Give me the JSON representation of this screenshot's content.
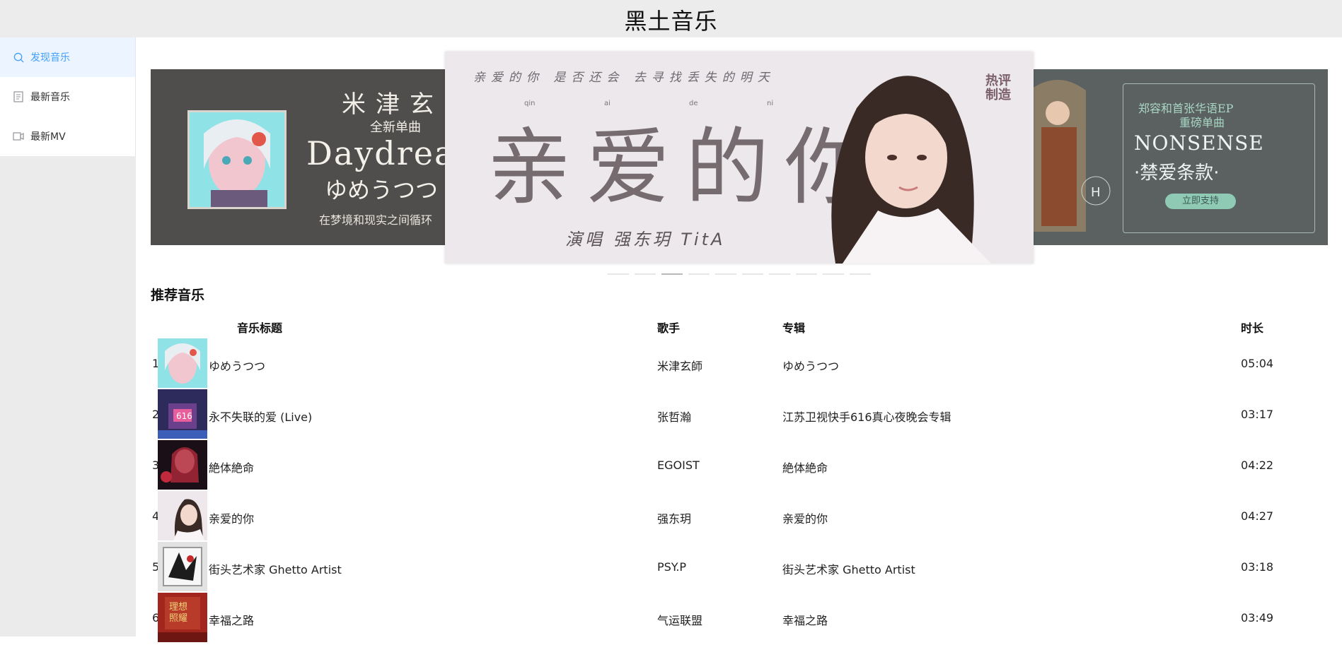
{
  "app": {
    "title": "黑土音乐"
  },
  "sidebar": {
    "items": [
      {
        "label": "发现音乐",
        "icon": "search-icon",
        "active": true
      },
      {
        "label": "最新音乐",
        "icon": "document-icon",
        "active": false
      },
      {
        "label": "最新MV",
        "icon": "video-icon",
        "active": false
      }
    ]
  },
  "carousel": {
    "slide_count": 10,
    "active_index": 2,
    "left": {
      "line1": "米津玄师",
      "line2": "全新单曲",
      "line3": "Daydrea",
      "line4": "ゆめうつつ",
      "line5": "在梦境和现实之间循环"
    },
    "center": {
      "top": "亲爱的你  是否还会  去寻找丢失的明天",
      "pinyin": [
        "qin",
        "ai",
        "de",
        "ni"
      ],
      "big": "亲爱的你",
      "singer": "演唱 强东玥 TitA",
      "tag": "热评\n制造"
    },
    "right": {
      "line1": "郑容和首张华语EP",
      "line2": "重磅单曲",
      "line3": "NONSENSE",
      "line4": "·禁爱条款·",
      "button": "立即支持"
    }
  },
  "section": {
    "title": "推荐音乐"
  },
  "table": {
    "headers": {
      "title": "音乐标题",
      "artist": "歌手",
      "album": "专辑",
      "duration": "时长"
    },
    "rows": [
      {
        "index": "1",
        "title": "ゆめうつつ",
        "artist": "米津玄師",
        "album": "ゆめうつつ",
        "duration": "05:04",
        "cover_color": "#7fd6d9"
      },
      {
        "index": "2",
        "title": "永不失联的爱 (Live)",
        "artist": "张哲瀚",
        "album": "江苏卫视快手616真心夜晚会专辑",
        "duration": "03:17",
        "cover_color": "#3a2f6b"
      },
      {
        "index": "3",
        "title": "絶体絶命",
        "artist": "EGOIST",
        "album": "絶体絶命",
        "duration": "04:22",
        "cover_color": "#2a1720"
      },
      {
        "index": "4",
        "title": "亲爱的你",
        "artist": "强东玥",
        "album": "亲爱的你",
        "duration": "04:27",
        "cover_color": "#e9e2e6"
      },
      {
        "index": "5",
        "title": "街头艺术家 Ghetto Artist",
        "artist": "PSY.P",
        "album": "街头艺术家 Ghetto Artist",
        "duration": "03:18",
        "cover_color": "#d8d8d8"
      },
      {
        "index": "6",
        "title": "幸福之路",
        "artist": "气运联盟",
        "album": "幸福之路",
        "duration": "03:49",
        "cover_color": "#a3261e"
      }
    ]
  }
}
